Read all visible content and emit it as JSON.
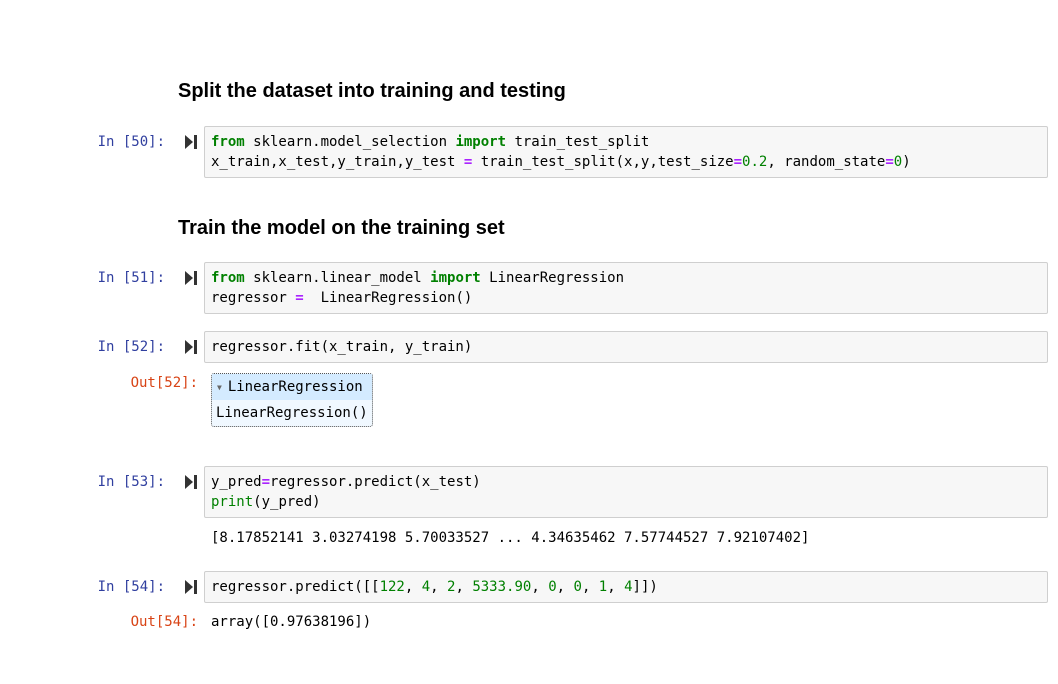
{
  "headings": [
    "Split the dataset into training and testing",
    "Train the model on the training set"
  ],
  "cells": [
    {
      "prompt": "In [50]:",
      "lines": [
        [
          [
            "from",
            "kw"
          ],
          [
            " sklearn.model_selection ",
            ""
          ],
          [
            "import",
            "kw"
          ],
          [
            " train_test_split",
            ""
          ]
        ],
        [
          [
            "x_train,x_test,y_train,y_test ",
            ""
          ],
          [
            "=",
            "op"
          ],
          [
            " train_test_split(x,y,test_size",
            ""
          ],
          [
            "=",
            "op"
          ],
          [
            "0.2",
            "num"
          ],
          [
            ", random_state",
            ""
          ],
          [
            "=",
            "op"
          ],
          [
            "0",
            "num"
          ],
          [
            ")",
            ""
          ]
        ]
      ]
    },
    {
      "prompt": "In [51]:",
      "lines": [
        [
          [
            "from",
            "kw"
          ],
          [
            " sklearn.linear_model ",
            ""
          ],
          [
            "import",
            "kw"
          ],
          [
            " LinearRegression",
            ""
          ]
        ],
        [
          [
            "regressor ",
            ""
          ],
          [
            "=",
            "op"
          ],
          [
            "  LinearRegression()",
            ""
          ]
        ]
      ]
    },
    {
      "prompt": "In [52]:",
      "lines": [
        [
          [
            "regressor.fit(x_train, y_train)",
            ""
          ]
        ]
      ]
    },
    {
      "prompt": "In [53]:",
      "lines": [
        [
          [
            "y_pred",
            ""
          ],
          [
            "=",
            "op"
          ],
          [
            "regressor.predict(x_test)",
            ""
          ]
        ],
        [
          [
            "print",
            "bi"
          ],
          [
            "(y_pred)",
            ""
          ]
        ]
      ]
    },
    {
      "prompt": "In [54]:",
      "lines": [
        [
          [
            "regressor.predict([[",
            ""
          ],
          [
            "122",
            "num"
          ],
          [
            ", ",
            ""
          ],
          [
            "4",
            "num"
          ],
          [
            ", ",
            ""
          ],
          [
            "2",
            "num"
          ],
          [
            ", ",
            ""
          ],
          [
            "5333.90",
            "num"
          ],
          [
            ", ",
            ""
          ],
          [
            "0",
            "num"
          ],
          [
            ", ",
            ""
          ],
          [
            "0",
            "num"
          ],
          [
            ", ",
            ""
          ],
          [
            "1",
            "num"
          ],
          [
            ", ",
            ""
          ],
          [
            "4",
            "num"
          ],
          [
            "]])",
            ""
          ]
        ]
      ]
    }
  ],
  "outputs": {
    "out52_prompt": "Out[52]:",
    "estimator_name": "LinearRegression",
    "estimator_repr": "LinearRegression()",
    "stdout53": "[8.17852141 3.03274198 5.70033527 ... 4.34635462 7.57744527 7.92107402]",
    "out54_prompt": "Out[54]:",
    "out54_value": "array([0.97638196])"
  }
}
